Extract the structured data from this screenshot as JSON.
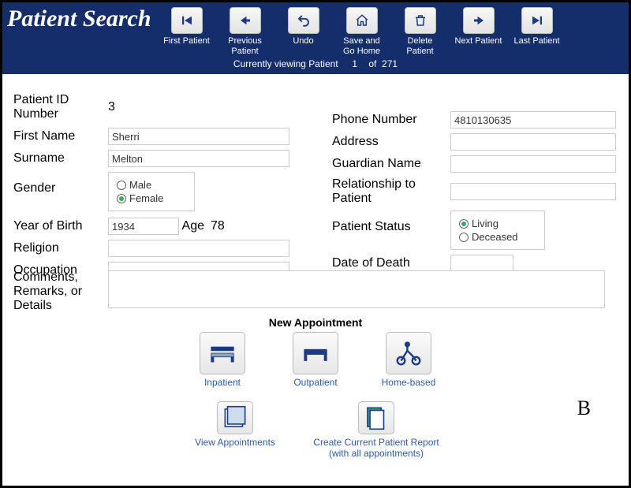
{
  "header": {
    "title": "Patient Search",
    "buttons": [
      {
        "label": "First Patient"
      },
      {
        "label": "Previous Patient"
      },
      {
        "label": "Undo"
      },
      {
        "label": "Save and Go Home"
      },
      {
        "label": "Delete Patient"
      },
      {
        "label": "Next Patient"
      },
      {
        "label": "Last Patient"
      }
    ],
    "status_prefix": "Currently viewing Patient",
    "status_index": "1",
    "status_of": "of",
    "status_total": "271"
  },
  "fields": {
    "patient_id_label": "Patient ID Number",
    "patient_id_value": "3",
    "first_name_label": "First Name",
    "first_name_value": "Sherri",
    "surname_label": "Surname",
    "surname_value": "Melton",
    "gender_label": "Gender",
    "gender_male": "Male",
    "gender_female": "Female",
    "gender_value": "Female",
    "yob_label": "Year of Birth",
    "yob_value": "1934",
    "age_label": "Age",
    "age_value": "78",
    "religion_label": "Religion",
    "religion_value": "",
    "occupation_label": "Occupation",
    "occupation_value": "",
    "phone_label": "Phone Number",
    "phone_value": "4810130635",
    "address_label": "Address",
    "address_value": "",
    "guardian_label": "Guardian Name",
    "guardian_value": "",
    "relationship_label": "Relationship to Patient",
    "relationship_value": "",
    "status_label": "Patient Status",
    "status_living": "Living",
    "status_deceased": "Deceased",
    "status_value": "Living",
    "dod_label": "Date of Death",
    "dod_value": "",
    "comments_label": "Comments, Remarks, or Details",
    "comments_value": ""
  },
  "appt": {
    "section_title": "New Appointment",
    "inpatient": "Inpatient",
    "outpatient": "Outpatient",
    "homebased": "Home-based",
    "view": "View Appointments",
    "report": "Create Current Patient Report (with all appointments)"
  },
  "mark": "B"
}
